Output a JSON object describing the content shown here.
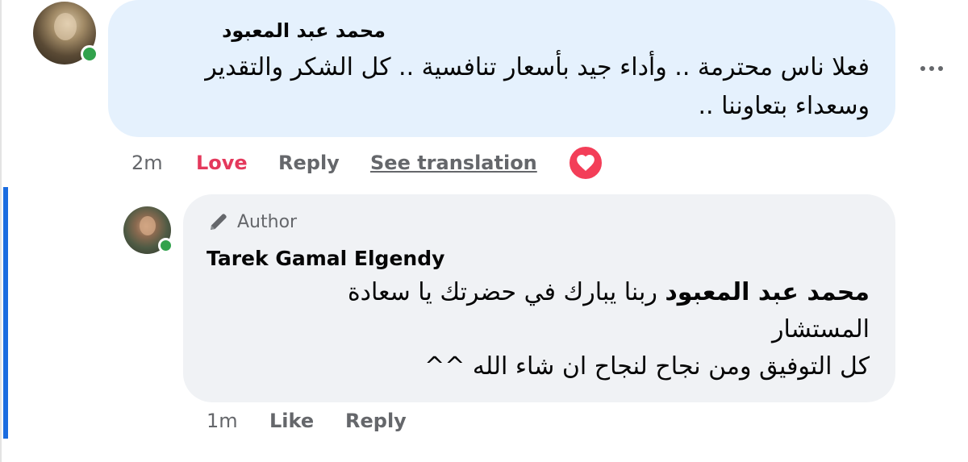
{
  "comment": {
    "author": "محمد عبد المعبود",
    "text": "فعلا ناس محترمة .. وأداء جيد بأسعار تنافسية .. كل الشكر والتقدير وسعداء بتعاوننا ..",
    "time": "2m",
    "actions": {
      "love": "Love",
      "reply": "Reply",
      "see_translation": "See translation"
    },
    "reaction_icon": "heart-icon",
    "more_icon": "more-options-icon"
  },
  "reply": {
    "badge": "Author",
    "badge_icon": "pencil-icon",
    "author": "Tarek Gamal Elgendy",
    "mention": "محمد عبد المعبود",
    "text_line1": " ربنا يبارك في حضرتك يا سعادة المستشار",
    "text_line2": "كل التوفيق ومن نجاح لنجاح ان شاء الله ^^",
    "time": "1m",
    "actions": {
      "like": "Like",
      "reply": "Reply"
    }
  },
  "colors": {
    "comment_bubble": "#e5f1fd",
    "reply_bubble": "#f0f2f5",
    "love": "#e4395c",
    "thread_line": "#1b6ce0",
    "online": "#31a24c"
  }
}
